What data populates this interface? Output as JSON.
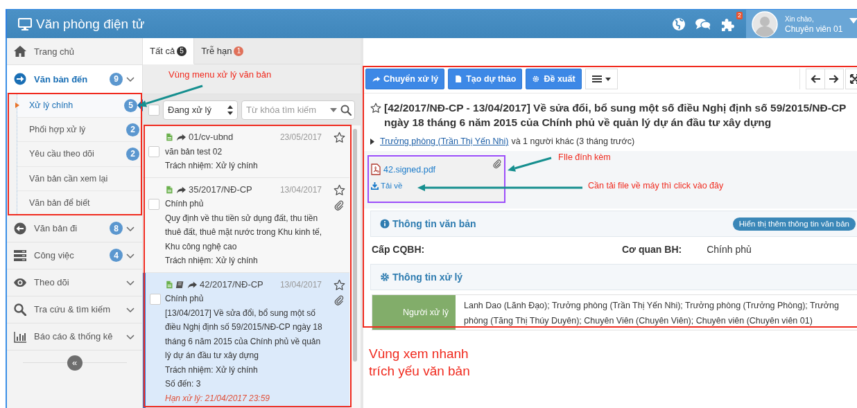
{
  "header": {
    "title": "Văn phòng điện tử",
    "notification_count": "2",
    "greeting": "Xin chào,",
    "user": "Chuyên viên 01"
  },
  "sidebar": {
    "items": [
      {
        "label": "Trang chủ",
        "selected": false
      },
      {
        "label": "Văn bản đến",
        "count": "9",
        "selected": true,
        "expanded": true,
        "children": [
          {
            "label": "Xử lý chính",
            "count": "5",
            "selected": true
          },
          {
            "label": "Phối hợp xử lý",
            "count": "2",
            "selected": false
          },
          {
            "label": "Yêu cầu theo dõi",
            "count": "2",
            "selected": false
          },
          {
            "label": "Văn bản cần xem lại",
            "selected": false
          },
          {
            "label": "Văn bản để biết",
            "selected": false
          }
        ]
      },
      {
        "label": "Văn bản đi",
        "count": "8",
        "selected": false,
        "expanded": false
      },
      {
        "label": "Công việc",
        "count": "4",
        "selected": false,
        "expanded": false
      },
      {
        "label": "Theo dõi",
        "selected": false,
        "expanded": false
      },
      {
        "label": "Tra cứu & tìm kiếm",
        "selected": false,
        "expanded": false
      },
      {
        "label": "Báo cáo & thống kê",
        "selected": false,
        "expanded": false
      }
    ],
    "collapse": "«"
  },
  "tabs": [
    {
      "label": "Tất cả",
      "count": "5",
      "color": "#333333",
      "selected": true
    },
    {
      "label": "Trễ hạn",
      "count": "1",
      "color": "#e0715a",
      "selected": false
    }
  ],
  "filter": {
    "checked": false,
    "status": "Đang xử lý",
    "search": {
      "placeholder": "Từ khóa tìm kiếm"
    }
  },
  "documents": [
    {
      "number": "01/cv-ubnd",
      "date": "23/05/2017",
      "summary": "văn bản test 02",
      "responsibility": "Trách nhiệm: Xử lý chính",
      "attachment": false,
      "checked": false,
      "starred": false,
      "selected": false
    },
    {
      "number": "35/2017/NĐ-CP",
      "date": "13/04/2017",
      "sender": "Chính phủ",
      "summary": "Quy định về thu tiền sử dụng đất, thu tiền thuê đất, thuê mặt nước trong Khu kinh tế, Khu công nghệ cao",
      "responsibility": "Trách nhiệm: Xử lý chính",
      "attachment": true,
      "checked": false,
      "starred": false,
      "selected": false
    },
    {
      "number": "42/2017/NĐ-CP",
      "date": "13/04/2017",
      "sender": "Chính phủ",
      "summary": "[13/04/2017] Về sửa đổi, bổ sung một số điều Nghị định số 59/2015/NĐ-CP ngày 18 tháng 6 năm 2015 của Chính phủ về quản lý dự án đầu tư xây dựng",
      "responsibility": "Trách nhiệm: Xử lý chính",
      "incoming": "Số đến: 3",
      "deadline": "Hạn xử lý: 21/04/2017 23:59",
      "attachment": true,
      "checked": false,
      "starred": false,
      "selected": true
    }
  ],
  "detail": {
    "actions": [
      {
        "label": "Chuyển xử lý"
      },
      {
        "label": "Tạo dự thảo"
      },
      {
        "label": "Đề xuất"
      }
    ],
    "starred": false,
    "title": "[42/2017/NĐ-CP - 13/04/2017] Về sửa đổi, bổ sung một số điều Nghị định số 59/2015/NĐ-CP ngày 18 tháng 6 năm 2015 của Chính phủ về quản lý dự án đầu tư xây dựng",
    "sender_link": "Trưởng phòng (Trần Thị Yến Nhi)",
    "sender_rest": "và 1 người khác (3 tháng trước)",
    "attachment": {
      "file": "42.signed.pdf",
      "download": "Tải về"
    },
    "sections": [
      {
        "title": "Thông tin văn bản",
        "button": "Hiển thị thêm thông tin văn bản",
        "fields": [
          {
            "label": "Cấp CQBH:"
          },
          {
            "label": "Cơ quan BH:",
            "value": "Chính phủ"
          }
        ]
      },
      {
        "title": "Thông tin xử lý",
        "rows": [
          {
            "label": "Người xử lý",
            "value": "Lanh Dao (Lãnh Đạo); Trưởng phòng (Trần Thị Yến Nhi); Trưởng phòng (Trưởng Phòng); Trưởng phòng (Tăng Thị Thúy Duyên); Chuyên Viên (Chuyên Viên); Chuyên viên (Chuyên viên 01)"
          }
        ]
      }
    ]
  },
  "annotations": [
    {
      "text": "Vùng menu xử lý văn bản"
    },
    {
      "text": "Vùng xem nhanh trích yếu văn bản"
    },
    {
      "text": "FIle đính kèm"
    },
    {
      "text": "Cần tải file về máy thì click vào đây"
    }
  ]
}
